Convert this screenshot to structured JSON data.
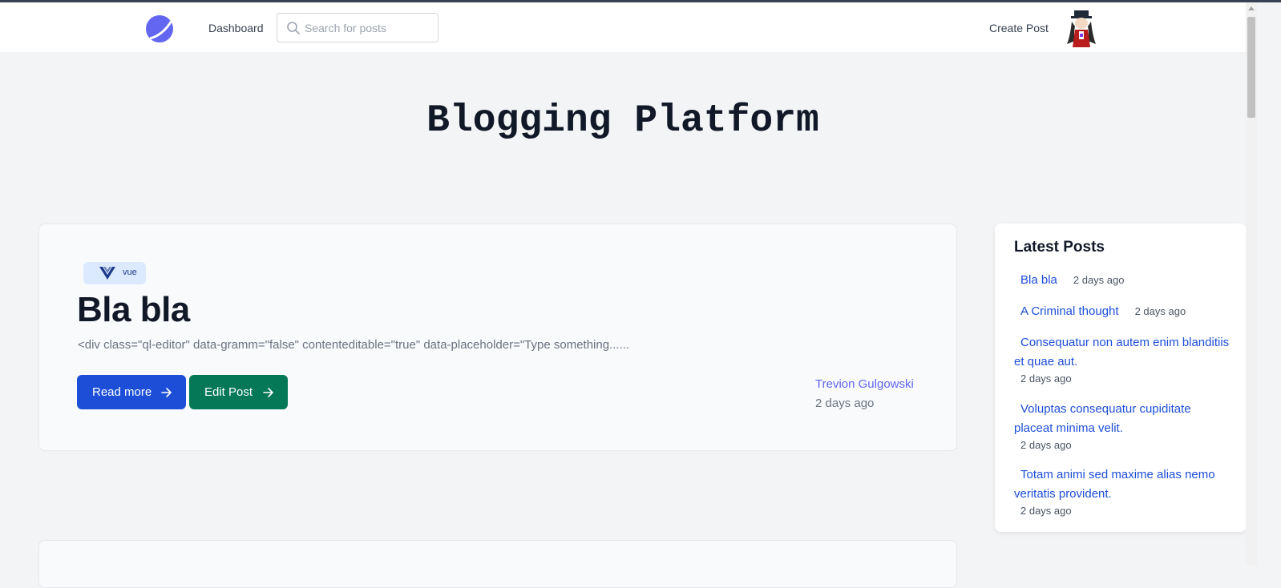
{
  "nav": {
    "dashboard_label": "Dashboard",
    "search_placeholder": "Search for posts",
    "create_post_label": "Create Post"
  },
  "page": {
    "title": "Blogging Platform"
  },
  "post": {
    "tag": "vue",
    "title": "Bla bla",
    "excerpt": "<div class=\"ql-editor\" data-gramm=\"false\" contenteditable=\"true\" data-placeholder=\"Type something......",
    "read_more_label": "Read more",
    "edit_label": "Edit Post",
    "author": "Trevion Gulgowski",
    "date": "2 days ago"
  },
  "sidebar": {
    "title": "Latest Posts",
    "items": [
      {
        "title": "Bla bla",
        "date": "2 days ago"
      },
      {
        "title": "A Criminal thought",
        "date": "2 days ago"
      },
      {
        "title": "Consequatur non autem enim blanditiis et quae aut.",
        "date": "2 days ago"
      },
      {
        "title": "Voluptas consequatur cupiditate placeat minima velit.",
        "date": "2 days ago"
      },
      {
        "title": "Totam animi sed maxime alias nemo veritatis provident.",
        "date": "2 days ago"
      }
    ]
  },
  "colors": {
    "primary_button": "#1d4ed8",
    "edit_button": "#047857",
    "link": "#1d4ed8",
    "author": "#6366f1",
    "logo": "#6366f1"
  }
}
